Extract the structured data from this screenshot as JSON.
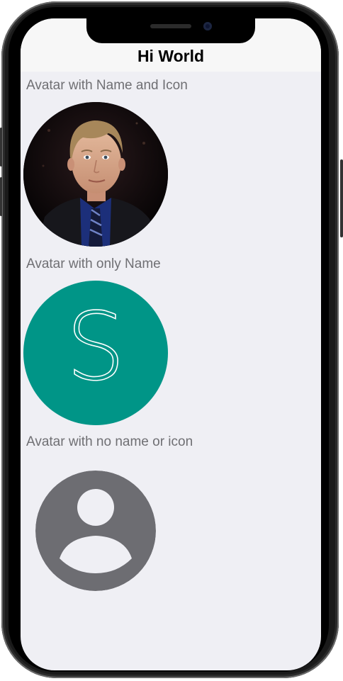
{
  "nav": {
    "title": "Hi World"
  },
  "sections": [
    {
      "label": "Avatar with Name and Icon"
    },
    {
      "label": "Avatar with only Name",
      "initial": "S"
    },
    {
      "label": "Avatar with no name or icon"
    }
  ],
  "colors": {
    "screen_background": "#efeff4",
    "navbar_background": "#f7f7f7",
    "label_text": "#6f6f73",
    "initial_avatar": "#009587",
    "placeholder_avatar": "#6d6d72"
  },
  "icons": {
    "placeholder": "person-placeholder-icon"
  }
}
